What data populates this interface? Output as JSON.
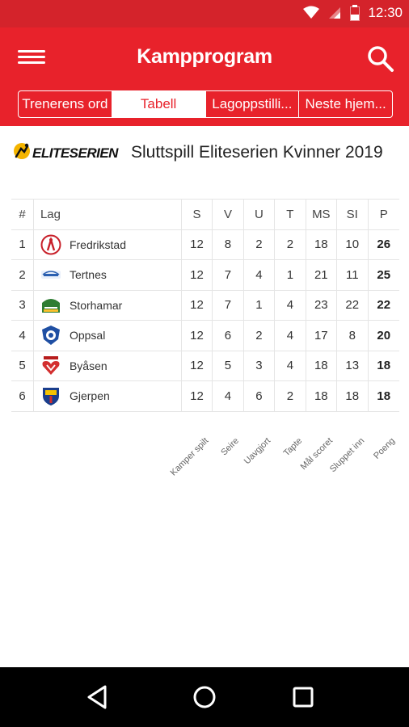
{
  "status": {
    "time": "12:30"
  },
  "appbar": {
    "title": "Kampprogram"
  },
  "tabs": [
    {
      "label": "Trenerens ord",
      "active": false
    },
    {
      "label": "Tabell",
      "active": true
    },
    {
      "label": "Lagoppstilli...",
      "active": false
    },
    {
      "label": "Neste hjem...",
      "active": false
    }
  ],
  "league": {
    "logo_text": "ELITESERIEN",
    "name": "Sluttspill Eliteserien Kvinner 2019"
  },
  "table": {
    "headers": [
      "#",
      "Lag",
      "S",
      "V",
      "U",
      "T",
      "MS",
      "SI",
      "P"
    ],
    "rows": [
      {
        "rank": "1",
        "team": "Fredrikstad",
        "s": "12",
        "v": "8",
        "u": "2",
        "t": "2",
        "ms": "18",
        "si": "10",
        "p": "26"
      },
      {
        "rank": "2",
        "team": "Tertnes",
        "s": "12",
        "v": "7",
        "u": "4",
        "t": "1",
        "ms": "21",
        "si": "11",
        "p": "25"
      },
      {
        "rank": "3",
        "team": "Storhamar",
        "s": "12",
        "v": "7",
        "u": "1",
        "t": "4",
        "ms": "23",
        "si": "22",
        "p": "22"
      },
      {
        "rank": "4",
        "team": "Oppsal",
        "s": "12",
        "v": "6",
        "u": "2",
        "t": "4",
        "ms": "17",
        "si": "8",
        "p": "20"
      },
      {
        "rank": "5",
        "team": "Byåsen",
        "s": "12",
        "v": "5",
        "u": "3",
        "t": "4",
        "ms": "18",
        "si": "13",
        "p": "18"
      },
      {
        "rank": "6",
        "team": "Gjerpen",
        "s": "12",
        "v": "4",
        "u": "6",
        "t": "2",
        "ms": "18",
        "si": "18",
        "p": "18"
      }
    ],
    "legend": [
      "Kamper spilt",
      "Seire",
      "Uavgjort",
      "Tapte",
      "Mål scoret",
      "Sluppet inn",
      "Poeng"
    ]
  },
  "colors": {
    "accent": "#e8222b",
    "statusbar": "#d4232b"
  }
}
